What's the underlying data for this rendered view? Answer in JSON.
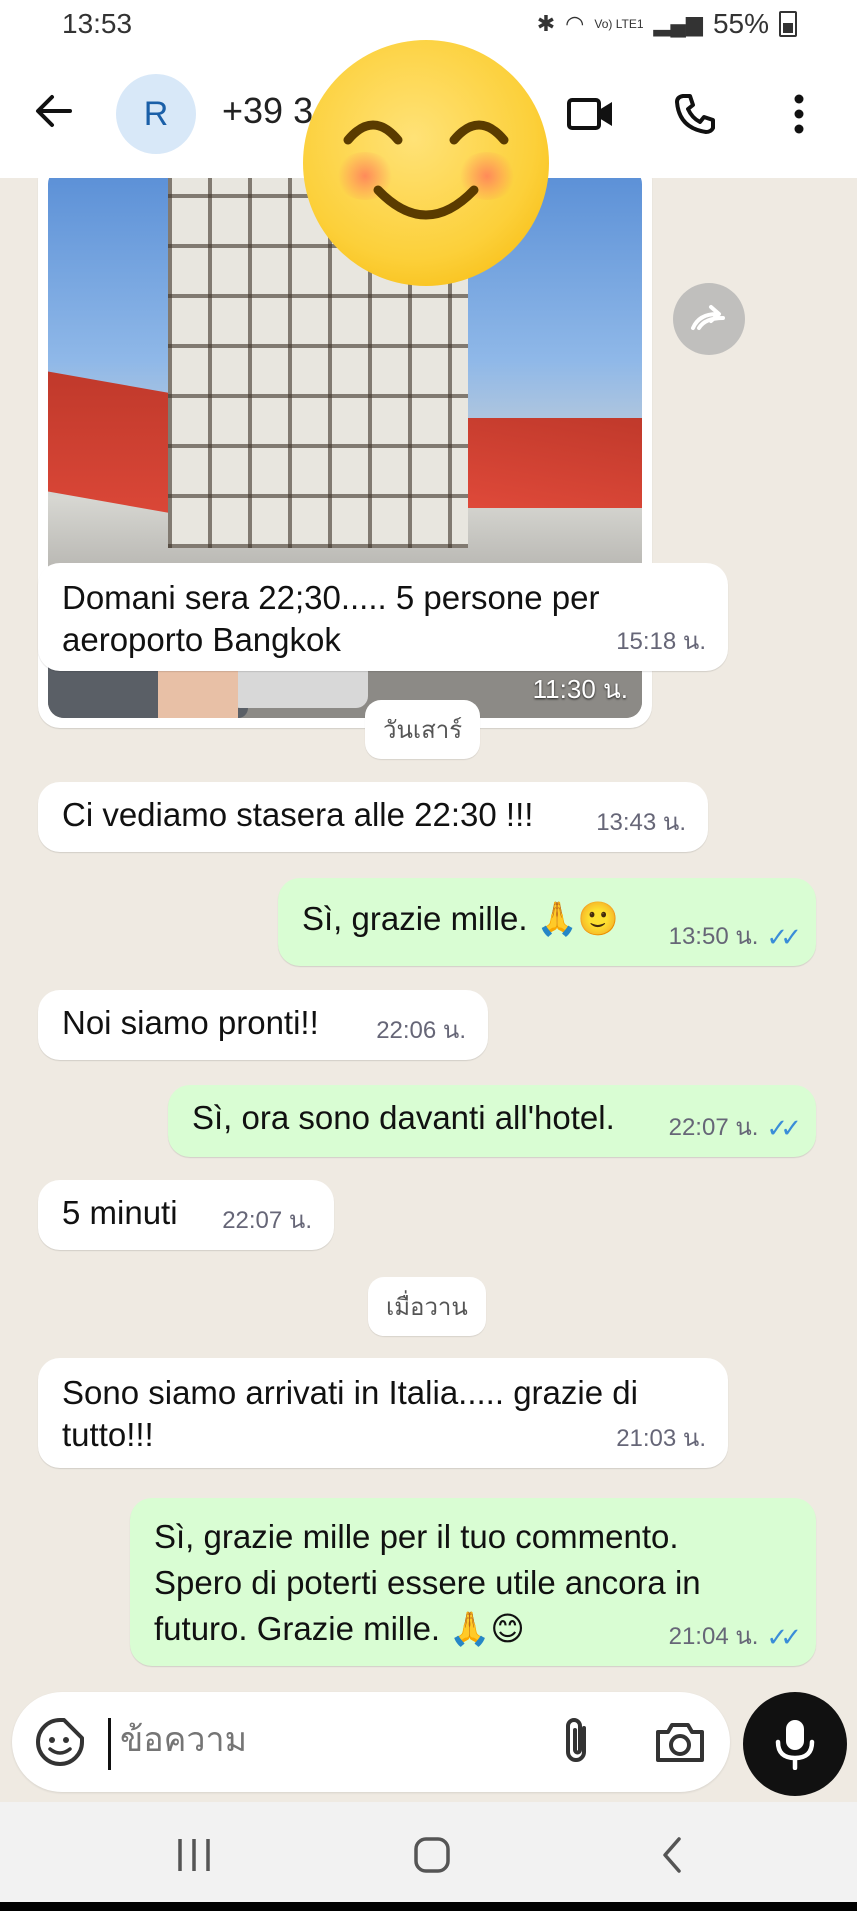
{
  "status_bar": {
    "time": "13:53",
    "battery": "55%",
    "net_label": "Vo) LTE1"
  },
  "header": {
    "avatar_letter": "R",
    "contact_name": "+39 3"
  },
  "image_message": {
    "time": "11:30 น."
  },
  "messages": [
    {
      "dir": "in",
      "text_lines": [
        "Domani sera 22;30..... 5 persone per",
        "aeroporto Bangkok"
      ],
      "time": "15:18 น."
    },
    {
      "dir": "in",
      "text_lines": [
        "Ci vediamo stasera alle 22:30 !!!"
      ],
      "time": "13:43 น."
    },
    {
      "dir": "out",
      "text_lines": [
        "Sì, grazie mille. 🙏🙂"
      ],
      "time": "13:50 น."
    },
    {
      "dir": "in",
      "text_lines": [
        "Noi siamo pronti!!"
      ],
      "time": "22:06 น."
    },
    {
      "dir": "out",
      "text_lines": [
        "Sì, ora sono davanti all'hotel."
      ],
      "time": "22:07 น."
    },
    {
      "dir": "in",
      "text_lines": [
        "5 minuti"
      ],
      "time": "22:07 น."
    },
    {
      "dir": "in",
      "text_lines": [
        "Sono siamo arrivati in Italia..... grazie di",
        "tutto!!!"
      ],
      "time": "21:03 น."
    },
    {
      "dir": "out",
      "text_lines": [
        "Sì, grazie mille per il tuo commento.",
        "Spero di poterti essere utile ancora in",
        "futuro. Grazie mille. 🙏😊"
      ],
      "time": "21:04 น."
    }
  ],
  "day_labels": [
    "วันเสาร์",
    "เมื่อวาน"
  ],
  "input": {
    "placeholder": "ข้อความ"
  },
  "colors": {
    "incoming": "#ffffff",
    "outgoing": "#d9fdd3",
    "background": "#efeae2",
    "read_ticks": "#3a8dd8"
  },
  "icons": [
    "back-arrow-icon",
    "video-call-icon",
    "phone-icon",
    "more-options-icon",
    "forward-icon",
    "sticker-icon",
    "attach-icon",
    "camera-icon",
    "mic-icon"
  ]
}
